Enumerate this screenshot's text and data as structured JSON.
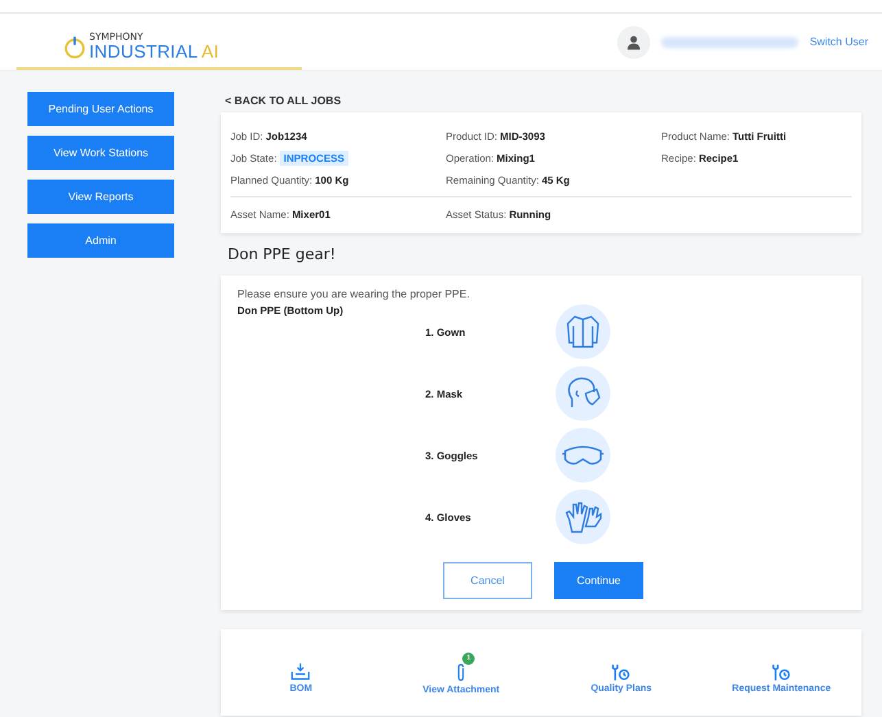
{
  "logo": {
    "top": "SYMPHONY",
    "main": "INDUSTRIAL",
    "accent": "AI"
  },
  "header": {
    "switch_user": "Switch User"
  },
  "sidebar": {
    "items": [
      {
        "label": "Pending User Actions"
      },
      {
        "label": "View Work Stations"
      },
      {
        "label": "View Reports"
      },
      {
        "label": "Admin"
      }
    ]
  },
  "back_link": "< BACK TO ALL JOBS",
  "job_details": {
    "rows": [
      [
        {
          "label": "Job ID:",
          "value": "Job1234",
          "kind": "text"
        },
        {
          "label": "Product ID:",
          "value": "MID-3093",
          "kind": "text"
        },
        {
          "label": "Product Name:",
          "value": "Tutti Fruitti",
          "kind": "text"
        }
      ],
      [
        {
          "label": "Job State:",
          "value": "INPROCESS",
          "kind": "badge"
        },
        {
          "label": "Operation:",
          "value": "Mixing1",
          "kind": "text"
        },
        {
          "label": "Recipe:",
          "value": "Recipe1",
          "kind": "text"
        }
      ],
      [
        {
          "label": "Planned Quantity:",
          "value": "100 Kg",
          "kind": "text"
        },
        {
          "label": "Remaining Quantity:",
          "value": "45 Kg",
          "kind": "text"
        }
      ]
    ],
    "asset": [
      {
        "label": "Asset Name:",
        "value": "Mixer01"
      },
      {
        "label": "Asset Status:",
        "value": "Running"
      }
    ]
  },
  "section_title": "Don PPE gear!",
  "ppe": {
    "instruction": "Please ensure you are wearing the proper PPE.",
    "heading": "Don PPE (Bottom Up)",
    "steps": [
      {
        "label": "1. Gown",
        "kind": "gown"
      },
      {
        "label": "2. Mask",
        "kind": "mask"
      },
      {
        "label": "3. Goggles",
        "kind": "goggles"
      },
      {
        "label": "4. Gloves",
        "kind": "gloves"
      }
    ],
    "buttons": [
      {
        "label": "Cancel",
        "kind": "secondary"
      },
      {
        "label": "Continue",
        "kind": "primary"
      }
    ]
  },
  "actions": [
    {
      "label": "BOM",
      "kind": "bom"
    },
    {
      "label": "View Attachment",
      "kind": "attachment",
      "badge": "1"
    },
    {
      "label": "Quality Plans",
      "kind": "quality"
    },
    {
      "label": "Request Maintenance",
      "kind": "maintenance"
    }
  ]
}
